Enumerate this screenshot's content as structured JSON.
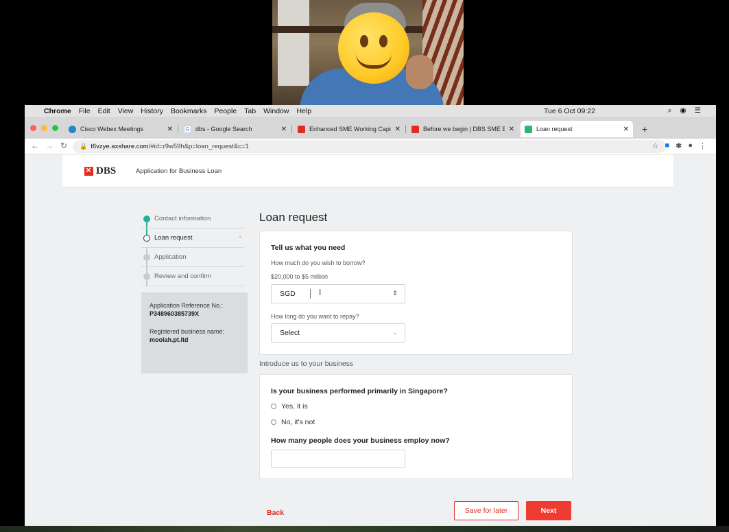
{
  "menubar": {
    "app": "Chrome",
    "items": [
      "File",
      "Edit",
      "View",
      "History",
      "Bookmarks",
      "People",
      "Tab",
      "Window",
      "Help"
    ],
    "clock": "Tue 6 Oct  09:22"
  },
  "tabs": [
    {
      "label": "Cisco Webex Meetings",
      "favicon_color": "#1e88c9"
    },
    {
      "label": "dbs - Google Search",
      "favicon_color": "#ffffff"
    },
    {
      "label": "Enhanced SME Working Capita",
      "favicon_color": "#e32b20"
    },
    {
      "label": "Before we begin | DBS SME Ba",
      "favicon_color": "#e32b20"
    },
    {
      "label": "Loan request",
      "favicon_color": "#2bb673"
    }
  ],
  "address": {
    "host": "t6vzye.axshare.com",
    "path": "/#id=r9w59h&p=loan_request&c=1"
  },
  "header": {
    "logo_text": "DBS",
    "app_title": "Application for Business Loan"
  },
  "steps": [
    {
      "label": "Contact information",
      "state": "done"
    },
    {
      "label": "Loan request",
      "state": "current"
    },
    {
      "label": "Application",
      "state": "pending"
    },
    {
      "label": "Review and confirm",
      "state": "pending"
    }
  ],
  "reference": {
    "ref_label": "Application Reference No.:",
    "ref_value": "P348960385739X",
    "name_label": "Registered business name:",
    "name_value": "moolah.pt.ltd"
  },
  "form": {
    "heading": "Loan request",
    "card1_title": "Tell us what you need",
    "borrow_question": "How much do you wish to borrow?",
    "borrow_range": "$20,000 to $5 million",
    "currency_value": "SGD",
    "repay_question": "How long do you want to repay?",
    "repay_value": "Select",
    "section_label": "Introduce us to your business",
    "singapore_question": "Is your business performed primarily in Singapore?",
    "option_yes": "Yes, it is",
    "option_no": "No, it's not",
    "employ_question": "How many people does your business employ now?",
    "employ_value": ""
  },
  "actions": {
    "back": "Back",
    "save": "Save for later",
    "next": "Next"
  }
}
